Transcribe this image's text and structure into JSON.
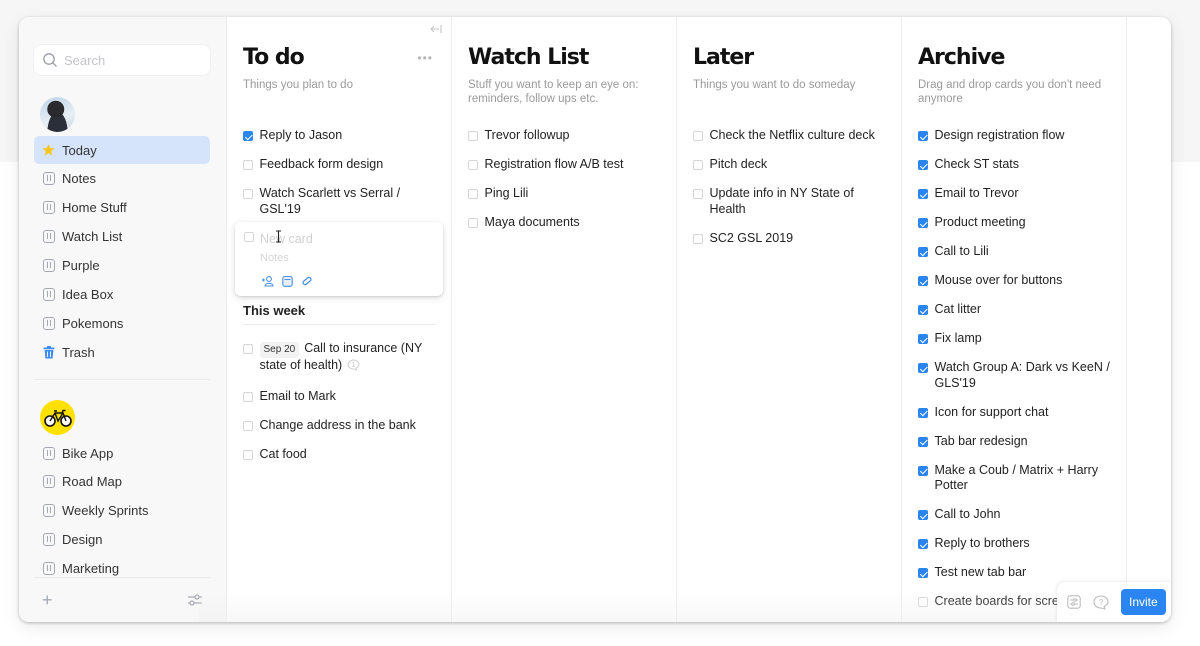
{
  "search": {
    "placeholder": "Search"
  },
  "sidebar": {
    "personal_items": [
      {
        "label": "Today",
        "icon": "star-icon",
        "active": true
      },
      {
        "label": "Notes",
        "icon": "board-icon"
      },
      {
        "label": "Home Stuff",
        "icon": "board-icon"
      },
      {
        "label": "Watch List",
        "icon": "board-icon"
      },
      {
        "label": "Purple",
        "icon": "board-icon"
      },
      {
        "label": "Idea Box",
        "icon": "board-icon"
      },
      {
        "label": "Pokemons",
        "icon": "board-icon"
      },
      {
        "label": "Trash",
        "icon": "trash-icon"
      }
    ],
    "team_items": [
      {
        "label": "Bike App",
        "icon": "board-icon"
      },
      {
        "label": "Road Map",
        "icon": "board-icon"
      },
      {
        "label": "Weekly Sprints",
        "icon": "board-icon"
      },
      {
        "label": "Design",
        "icon": "board-icon"
      },
      {
        "label": "Marketing",
        "icon": "board-icon"
      }
    ],
    "add_label": "+"
  },
  "columns": {
    "todo": {
      "title": "To do",
      "description": "Things you plan to do",
      "items": [
        {
          "text": "Reply to Jason",
          "checked": true
        },
        {
          "text": "Feedback form design",
          "checked": false
        },
        {
          "text": "Watch Scarlett vs Serral / GSL'19",
          "checked": false
        }
      ],
      "new_card": {
        "title_placeholder": "New card",
        "notes_placeholder": "Notes"
      },
      "section": {
        "title": "This week",
        "items": [
          {
            "date": "Sep 20",
            "text": "Call to insurance (NY state of health)",
            "checked": false,
            "note_count": "1"
          },
          {
            "text": "Email to Mark",
            "checked": false
          },
          {
            "text": "Change address in the bank",
            "checked": false
          },
          {
            "text": "Cat food",
            "checked": false
          }
        ]
      }
    },
    "watch": {
      "title": "Watch List",
      "description": "Stuff you want to keep an eye on: reminders, follow ups etc.",
      "items": [
        {
          "text": "Trevor followup",
          "checked": false
        },
        {
          "text": "Registration flow A/B test",
          "checked": false
        },
        {
          "text": "Ping Lili",
          "checked": false
        },
        {
          "text": "Maya documents",
          "checked": false
        }
      ]
    },
    "later": {
      "title": "Later",
      "description": "Things you want to do someday",
      "items": [
        {
          "text": "Check the Netflix culture deck",
          "checked": false
        },
        {
          "text": "Pitch deck",
          "checked": false
        },
        {
          "text": "Update info in NY State of Health",
          "checked": false
        },
        {
          "text": "SC2 GSL 2019",
          "checked": false
        }
      ]
    },
    "archive": {
      "title": "Archive",
      "description": "Drag and drop cards you don't need anymore",
      "items": [
        {
          "text": "Design registration flow",
          "checked": true
        },
        {
          "text": "Check ST stats",
          "checked": true
        },
        {
          "text": "Email to Trevor",
          "checked": true
        },
        {
          "text": "Product meeting",
          "checked": true
        },
        {
          "text": "Call to Lili",
          "checked": true
        },
        {
          "text": "Mouse over for buttons",
          "checked": true
        },
        {
          "text": "Cat litter",
          "checked": true
        },
        {
          "text": "Fix lamp",
          "checked": true
        },
        {
          "text": "Watch Group A: Dark vs KeeN / GLS'19",
          "checked": true
        },
        {
          "text": "Icon for support chat",
          "checked": true
        },
        {
          "text": "Tab bar redesign",
          "checked": true
        },
        {
          "text": "Make a Coub / Matrix + Harry Potter",
          "checked": true
        },
        {
          "text": "Call to John",
          "checked": true
        },
        {
          "text": "Reply to brothers",
          "checked": true
        },
        {
          "text": "Test new tab bar",
          "checked": true
        },
        {
          "text": "Create boards for screenshots",
          "checked": false
        }
      ]
    }
  },
  "bottom_bar": {
    "invite_label": "Invite"
  },
  "colors": {
    "accent": "#2a85f0",
    "active_nav": "#d5e4fb",
    "star": "#f7c51e",
    "bike_avatar": "#ffe100"
  }
}
